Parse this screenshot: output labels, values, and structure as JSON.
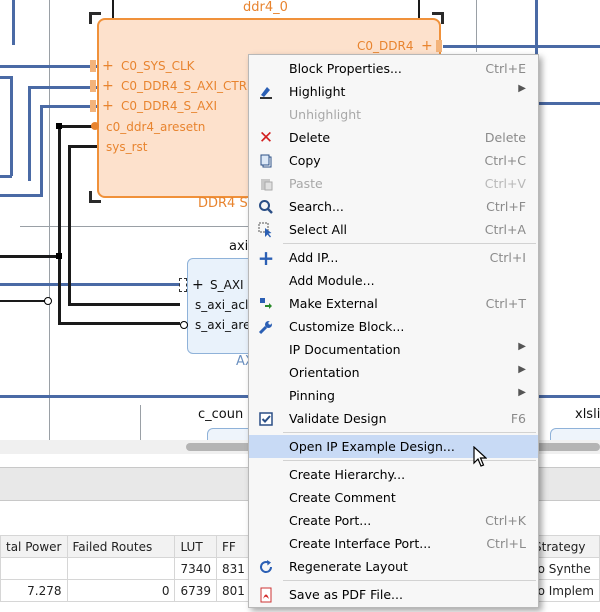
{
  "canvas": {
    "ddr4_block": {
      "instance_name": "ddr4_0",
      "caption": "DDR4 S",
      "ports_left": [
        "C0_SYS_CLK",
        "C0_DDR4_S_AXI_CTRL",
        "C0_DDR4_S_AXI",
        "c0_ddr4_aresetn",
        "sys_rst"
      ],
      "port_right": "C0_DDR4"
    },
    "axi_block": {
      "instance_name": "axi",
      "caption": "AX",
      "ports": [
        "S_AXI",
        "s_axi_acl",
        "s_axi_are"
      ]
    },
    "labels": {
      "c_counter": "c_coun",
      "xlslice": "xlsli"
    }
  },
  "bottom_panel": {
    "table": {
      "headers": [
        "tal Power",
        "Failed Routes",
        "LUT",
        "FF",
        "",
        "n Strategy"
      ],
      "rows": [
        [
          "",
          "",
          "7340",
          "831",
          "",
          "ado Synthe"
        ],
        [
          "7.278",
          "0",
          "6739",
          "801",
          "",
          "ado Implem"
        ]
      ]
    }
  },
  "context_menu": {
    "items": [
      {
        "label": "Block Properties...",
        "shortcut": "Ctrl+E",
        "icon": "",
        "enabled": true
      },
      {
        "label": "Highlight",
        "shortcut": "",
        "icon": "highlight-icon",
        "enabled": true,
        "submenu": true
      },
      {
        "label": "Unhighlight",
        "shortcut": "",
        "icon": "",
        "enabled": false
      },
      {
        "label": "Delete",
        "shortcut": "Delete",
        "icon": "delete-icon",
        "enabled": true
      },
      {
        "label": "Copy",
        "shortcut": "Ctrl+C",
        "icon": "copy-icon",
        "enabled": true
      },
      {
        "label": "Paste",
        "shortcut": "Ctrl+V",
        "icon": "paste-icon",
        "enabled": false
      },
      {
        "label": "Search...",
        "shortcut": "Ctrl+F",
        "icon": "search-icon",
        "enabled": true
      },
      {
        "label": "Select All",
        "shortcut": "Ctrl+A",
        "icon": "select-all-icon",
        "enabled": true
      },
      {
        "label": "Add IP...",
        "shortcut": "Ctrl+I",
        "icon": "add-icon",
        "enabled": true
      },
      {
        "label": "Add Module...",
        "shortcut": "",
        "icon": "",
        "enabled": true
      },
      {
        "label": "Make External",
        "shortcut": "Ctrl+T",
        "icon": "make-external-icon",
        "enabled": true
      },
      {
        "label": "Customize Block...",
        "shortcut": "",
        "icon": "wrench-icon",
        "enabled": true
      },
      {
        "label": "IP Documentation",
        "shortcut": "",
        "icon": "",
        "enabled": true,
        "submenu": true
      },
      {
        "label": "Orientation",
        "shortcut": "",
        "icon": "",
        "enabled": true,
        "submenu": true
      },
      {
        "label": "Pinning",
        "shortcut": "",
        "icon": "",
        "enabled": true,
        "submenu": true
      },
      {
        "label": "Validate Design",
        "shortcut": "F6",
        "icon": "validate-icon",
        "enabled": true
      },
      {
        "label": "Open IP Example Design...",
        "shortcut": "",
        "icon": "",
        "enabled": true,
        "highlighted": true
      },
      {
        "label": "Create Hierarchy...",
        "shortcut": "",
        "icon": "",
        "enabled": true
      },
      {
        "label": "Create Comment",
        "shortcut": "",
        "icon": "",
        "enabled": true
      },
      {
        "label": "Create Port...",
        "shortcut": "Ctrl+K",
        "icon": "",
        "enabled": true
      },
      {
        "label": "Create Interface Port...",
        "shortcut": "Ctrl+L",
        "icon": "",
        "enabled": true
      },
      {
        "label": "Regenerate Layout",
        "shortcut": "",
        "icon": "regenerate-icon",
        "enabled": true
      },
      {
        "label": "Save as PDF File...",
        "shortcut": "",
        "icon": "pdf-icon",
        "enabled": true
      }
    ]
  },
  "colors": {
    "ddr4_fill": "#fde1cc",
    "ddr4_border": "#f0913a",
    "port_orange": "#e8842f",
    "bus_wire": "#4a6aa5",
    "menu_highlight": "#c8daf5"
  }
}
